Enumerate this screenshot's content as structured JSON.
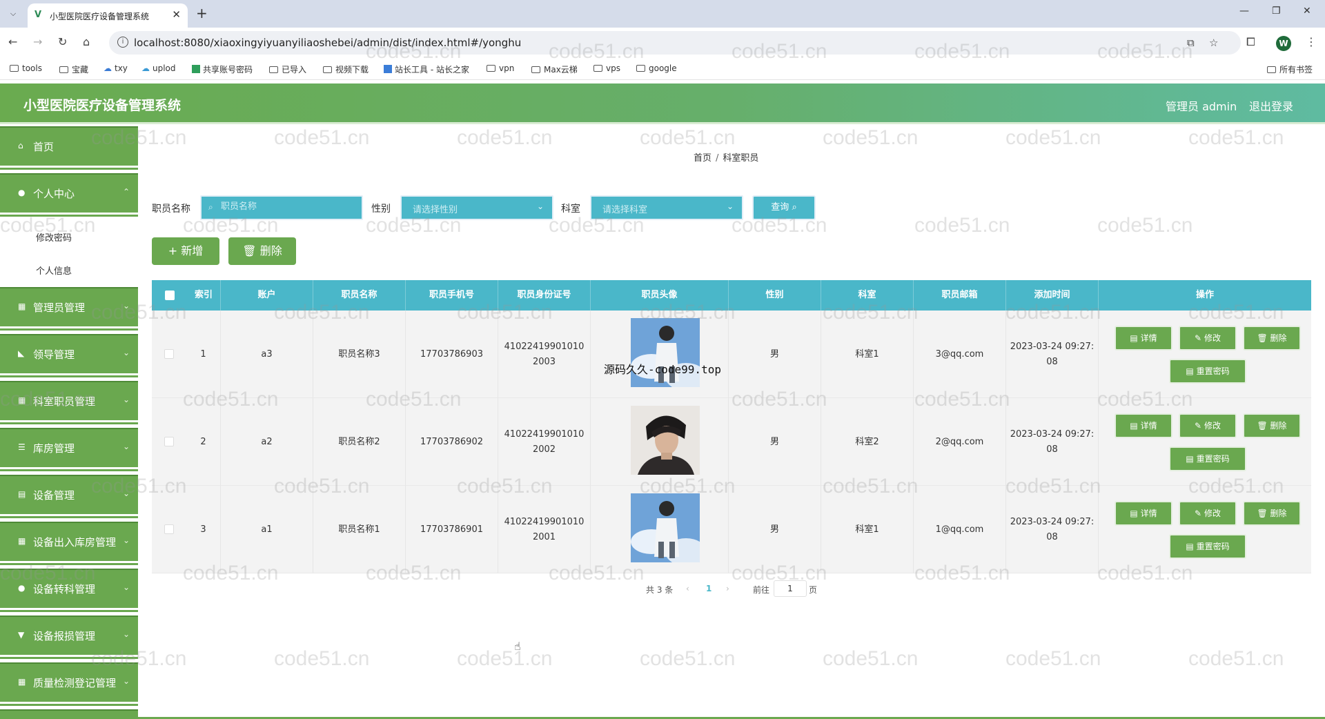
{
  "browser": {
    "tab_title": "小型医院医疗设备管理系统",
    "url": "localhost:8080/xiaoxingyiyuanyiliaoshebei/admin/dist/index.html#/yonghu",
    "profile_initial": "W",
    "bookmarks": [
      "tools",
      "宝藏",
      "txy",
      "uplod",
      "共享账号密码",
      "已导入",
      "视频下载",
      "站长工具 - 站长之家",
      "vpn",
      "Max云梯",
      "vps",
      "google"
    ],
    "all_bookmarks": "所有书签"
  },
  "header": {
    "title": "小型医院医疗设备管理系统",
    "user": "管理员 admin",
    "logout": "退出登录"
  },
  "sidebar": {
    "items": [
      {
        "label": "首页"
      },
      {
        "label": "个人中心"
      },
      {
        "label": "管理员管理"
      },
      {
        "label": "领导管理"
      },
      {
        "label": "科室职员管理"
      },
      {
        "label": "库房管理"
      },
      {
        "label": "设备管理"
      },
      {
        "label": "设备出入库房管理"
      },
      {
        "label": "设备转科管理"
      },
      {
        "label": "设备报损管理"
      },
      {
        "label": "质量检测登记管理"
      }
    ],
    "subitems": [
      {
        "label": "修改密码"
      },
      {
        "label": "个人信息"
      }
    ]
  },
  "breadcrumb": {
    "home": "首页",
    "sep": "/",
    "current": "科室职员"
  },
  "search": {
    "name_label": "职员名称",
    "name_placeholder": "职员名称",
    "gender_label": "性别",
    "gender_placeholder": "请选择性别",
    "dept_label": "科室",
    "dept_placeholder": "请选择科室",
    "query_button": "查询"
  },
  "actions": {
    "add": "新增",
    "delete": "删除"
  },
  "table": {
    "headers": [
      "索引",
      "账户",
      "职员名称",
      "职员手机号",
      "职员身份证号",
      "职员头像",
      "性别",
      "科室",
      "职员邮箱",
      "添加时间",
      "操作"
    ],
    "rows": [
      {
        "index": "1",
        "account": "a3",
        "name": "职员名称3",
        "phone": "17703786903",
        "idcard1": "41022419901010",
        "idcard2": "2003",
        "gender": "男",
        "dept": "科室1",
        "email": "3@qq.com",
        "time1": "2023-03-24 09:27:",
        "time2": "08",
        "avatar": "avatar-a"
      },
      {
        "index": "2",
        "account": "a2",
        "name": "职员名称2",
        "phone": "17703786902",
        "idcard1": "41022419901010",
        "idcard2": "2002",
        "gender": "男",
        "dept": "科室2",
        "email": "2@qq.com",
        "time1": "2023-03-24 09:27:",
        "time2": "08",
        "avatar": "avatar-b"
      },
      {
        "index": "3",
        "account": "a1",
        "name": "职员名称1",
        "phone": "17703786901",
        "idcard1": "41022419901010",
        "idcard2": "2001",
        "gender": "男",
        "dept": "科室1",
        "email": "1@qq.com",
        "time1": "2023-03-24 09:27:",
        "time2": "08",
        "avatar": "avatar-a"
      }
    ],
    "ops": {
      "detail": "详情",
      "edit": "修改",
      "delete": "删除",
      "reset": "重置密码"
    }
  },
  "pagination": {
    "total": "共 3 条",
    "page": "1",
    "goto": "前往",
    "goto_value": "1",
    "unit": "页"
  },
  "overlay_text": "源码久久-code99.top",
  "watermark": "code51.cn",
  "colors": {
    "accent_green": "#6aa84f",
    "accent_teal": "#4ab7c9"
  }
}
